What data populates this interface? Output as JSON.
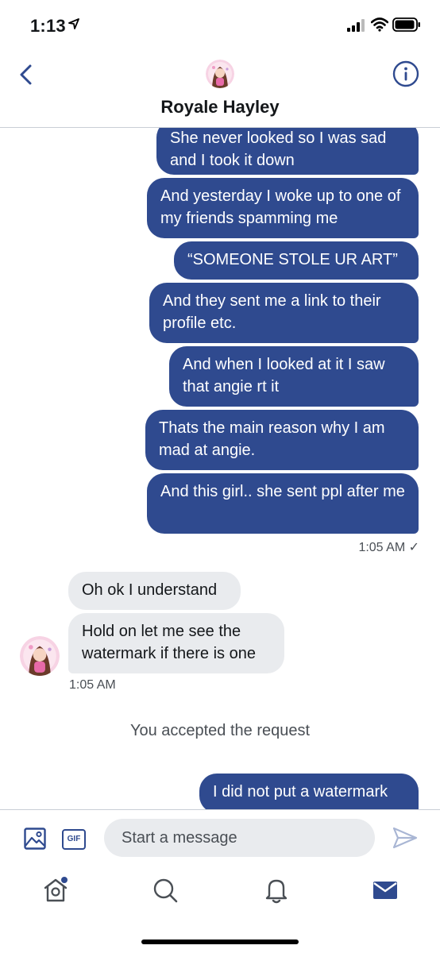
{
  "status_bar": {
    "time": "1:13"
  },
  "header": {
    "title": "Royale Hayley"
  },
  "messages": [
    {
      "side": "out",
      "text": "She never looked so I was sad and I took it down"
    },
    {
      "side": "out",
      "text": "And yesterday I woke up to one of my friends spamming me"
    },
    {
      "side": "out",
      "text": "“SOMEONE STOLE UR ART”"
    },
    {
      "side": "out",
      "text": "And they sent me a link to their profile etc."
    },
    {
      "side": "out",
      "text": "And when I looked at it I saw that angie rt it"
    },
    {
      "side": "out",
      "text": "Thats the main reason why I am mad at angie."
    },
    {
      "side": "out",
      "text": "And this girl.. she sent ppl after me"
    },
    {
      "side": "in",
      "text": "Oh ok I understand"
    },
    {
      "side": "in",
      "text": "Hold on let me see the watermark if there is one"
    },
    {
      "side": "out",
      "text": "I did not put a watermark"
    }
  ],
  "timestamps": {
    "outgoing": "1:05 AM",
    "outgoing_check": "✓",
    "incoming": "1:05 AM"
  },
  "system_message": "You accepted the request",
  "composer": {
    "placeholder": "Start a message",
    "gif_label": "GIF"
  },
  "colors": {
    "accent": "#2f4a8f",
    "incoming_bubble": "#e9ebee",
    "secondary_text": "#4a4f55"
  },
  "icons": {
    "back": "chevron-left-icon",
    "info": "info-icon",
    "image": "image-icon",
    "gif": "gif-icon",
    "send": "send-icon",
    "home": "home-icon",
    "search": "search-icon",
    "notifications": "bell-icon",
    "messages": "envelope-icon"
  }
}
